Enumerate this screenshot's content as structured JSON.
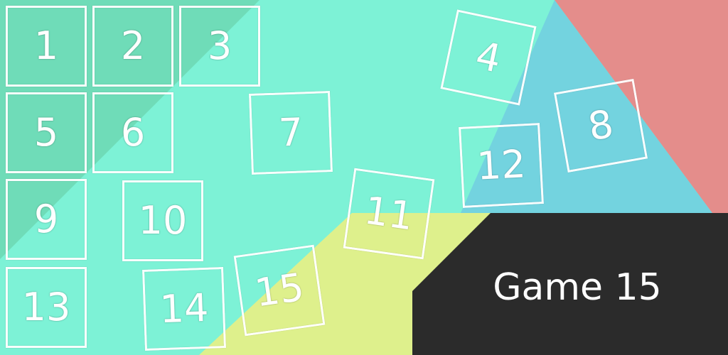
{
  "title": "Game 15",
  "colors": {
    "mint": "#7df2d6",
    "mint_dark": "#6fdcb8",
    "blue": "#73d3df",
    "red": "#e48d8b",
    "yellow": "#def08c",
    "dark": "#2b2b2b"
  },
  "tiles": [
    {
      "label": "1"
    },
    {
      "label": "2"
    },
    {
      "label": "3"
    },
    {
      "label": "4"
    },
    {
      "label": "5"
    },
    {
      "label": "6"
    },
    {
      "label": "7"
    },
    {
      "label": "8"
    },
    {
      "label": "9"
    },
    {
      "label": "10"
    },
    {
      "label": "11"
    },
    {
      "label": "12"
    },
    {
      "label": "13"
    },
    {
      "label": "14"
    },
    {
      "label": "15"
    }
  ]
}
